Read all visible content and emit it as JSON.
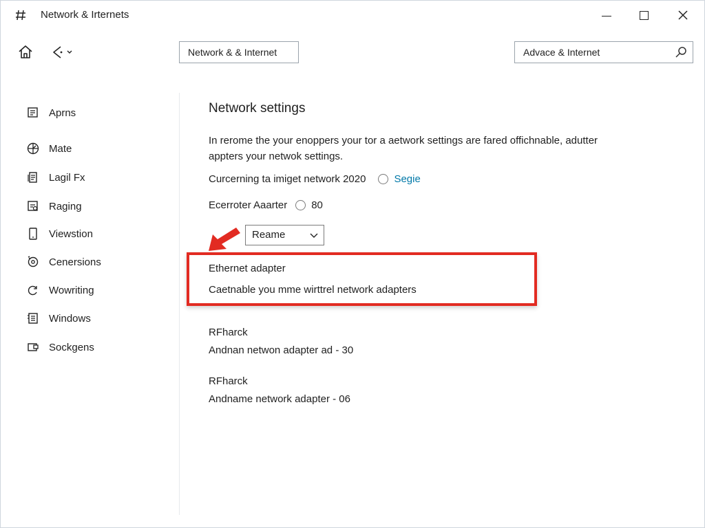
{
  "window": {
    "title": "Network & Irternets"
  },
  "toolbar": {
    "breadcrumb": "Network & & Internet",
    "search": {
      "value": "Advace & Internet",
      "placeholder": ""
    }
  },
  "sidebar": {
    "items": [
      {
        "label": "Aprns",
        "icon": "apps-icon"
      },
      {
        "label": "Mate",
        "icon": "globe-icon"
      },
      {
        "label": "Lagil Fx",
        "icon": "document-icon"
      },
      {
        "label": "Raging",
        "icon": "image-icon"
      },
      {
        "label": "Viewstion",
        "icon": "tablet-icon"
      },
      {
        "label": "Cenersions",
        "icon": "settings-icon"
      },
      {
        "label": "Wowriting",
        "icon": "refresh-icon"
      },
      {
        "label": "Windows",
        "icon": "list-icon"
      },
      {
        "label": "Sockgens",
        "icon": "display-icon"
      }
    ]
  },
  "main": {
    "title": "Network settings",
    "description_line1": "In rerome the your enoppers your tor a aetwork settings are fared offichnable, adutter",
    "description_line2": "appters your netwok settings.",
    "row1": {
      "label": "Curcerning  ta imiget network 2020",
      "link": "Segie"
    },
    "row2": {
      "label": "Ecerroter Aaarter",
      "value": "80"
    },
    "dropdown": {
      "selected": "Reame"
    },
    "highlighted": {
      "title": "Ethernet adapter",
      "subtitle": "Caetnable you mme wirttrel network adapters"
    },
    "adapters": [
      {
        "name": "RFharck",
        "detail": "Andnan netwon adapter ad  - 30"
      },
      {
        "name": "RFharck",
        "detail": "Andname network adapter - 06"
      }
    ]
  },
  "colors": {
    "accent_link": "#0078a8",
    "highlight_border": "#e22b22"
  }
}
